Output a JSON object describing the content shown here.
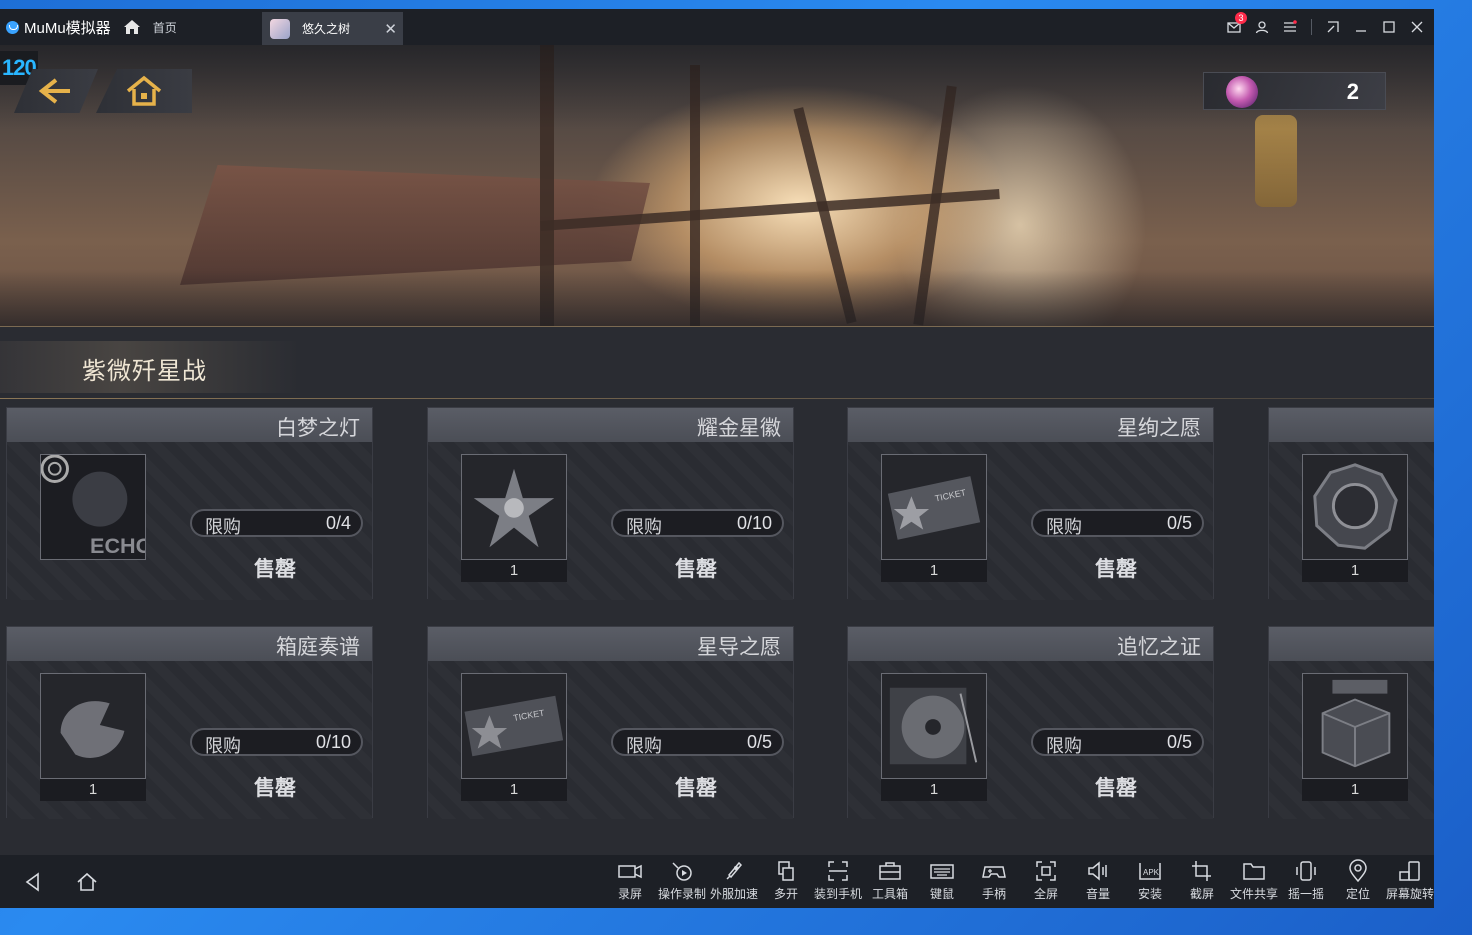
{
  "app": {
    "name": "MuMu模拟器",
    "home_tab": "首页",
    "game_tab": "悠久之树",
    "notification_count": "3",
    "fps": "120"
  },
  "game": {
    "currency_amount": "2",
    "section_title": "紫微歼星战",
    "limit_label": "限购",
    "sold_label": "售罄",
    "items": [
      {
        "name": "白梦之灯",
        "limit": "0/4",
        "qty": ""
      },
      {
        "name": "耀金星徽",
        "limit": "0/10",
        "qty": "1"
      },
      {
        "name": "星绚之愿",
        "limit": "0/5",
        "qty": "1"
      },
      {
        "name": "",
        "limit": "",
        "qty": "1"
      },
      {
        "name": "箱庭奏谱",
        "limit": "0/10",
        "qty": "1"
      },
      {
        "name": "星导之愿",
        "limit": "0/5",
        "qty": "1"
      },
      {
        "name": "追忆之证",
        "limit": "0/5",
        "qty": "1"
      },
      {
        "name": "",
        "limit": "",
        "qty": "1"
      }
    ]
  },
  "toolbar": {
    "record": "录屏",
    "macro": "操作录制",
    "accelerate": "外服加速",
    "multi": "多开",
    "to_phone": "装到手机",
    "toolbox": "工具箱",
    "keyboard": "键鼠",
    "gamepad": "手柄",
    "fullscreen": "全屏",
    "volume": "音量",
    "install": "安装",
    "screenshot": "截屏",
    "file_share": "文件共享",
    "shake": "摇一摇",
    "location": "定位",
    "rotate": "屏幕旋转"
  },
  "colors": {
    "desktop": "#2a8af0",
    "titlebar": "#1d2026",
    "fps": "#29b6ff",
    "accent_gold": "#e6b24a"
  }
}
